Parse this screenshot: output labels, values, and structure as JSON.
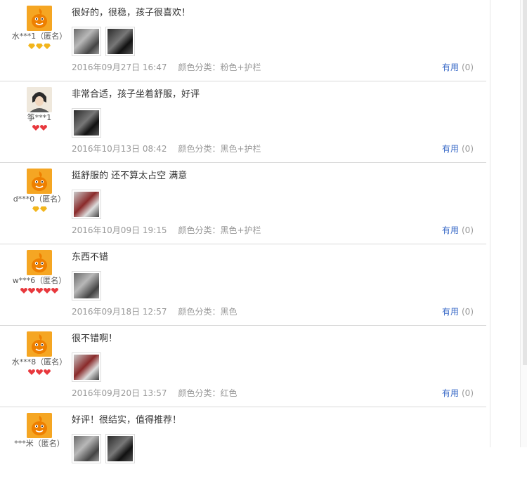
{
  "reviews": [
    {
      "user": "水***1（匿名）",
      "avatar_icon": "orange-mascot-avatar",
      "badge": {
        "type": "gold-diamond",
        "count": 3
      },
      "text": "很好的，很稳，孩子很喜欢！",
      "photos": 2,
      "date": "2016年09月27日 16:47",
      "sku": "颜色分类：粉色+护栏",
      "useful_label": "有用",
      "useful_count": "(0)"
    },
    {
      "user": "筝***1",
      "avatar_icon": "photo-avatar",
      "badge": {
        "type": "red-heart",
        "count": 2
      },
      "text": "非常合适，孩子坐着舒服，好评",
      "photos": 1,
      "date": "2016年10月13日 08:42",
      "sku": "颜色分类：黑色+护栏",
      "useful_label": "有用",
      "useful_count": "(0)"
    },
    {
      "user": "d***0（匿名）",
      "avatar_icon": "orange-mascot-avatar",
      "badge": {
        "type": "gold-diamond",
        "count": 2
      },
      "text": "挺舒服的 还不算太占空 满意",
      "photos": 1,
      "date": "2016年10月09日 19:15",
      "sku": "颜色分类：黑色+护栏",
      "useful_label": "有用",
      "useful_count": "(0)"
    },
    {
      "user": "w***6（匿名）",
      "avatar_icon": "orange-mascot-avatar",
      "badge": {
        "type": "red-heart",
        "count": 5
      },
      "text": "东西不错",
      "photos": 1,
      "date": "2016年09月18日 12:57",
      "sku": "颜色分类：黑色",
      "useful_label": "有用",
      "useful_count": "(0)"
    },
    {
      "user": "水***8（匿名）",
      "avatar_icon": "orange-mascot-avatar",
      "badge": {
        "type": "red-heart",
        "count": 3
      },
      "text": "很不错啊！",
      "photos": 1,
      "date": "2016年09月20日 13:57",
      "sku": "颜色分类：红色",
      "useful_label": "有用",
      "useful_count": "(0)"
    },
    {
      "user": "***米（匿名）",
      "avatar_icon": "orange-mascot-avatar",
      "badge": {
        "type": "none",
        "count": 0
      },
      "text": "好评！很结实，值得推荐！",
      "photos": 2,
      "date": "",
      "sku": "",
      "useful_label": "",
      "useful_count": ""
    }
  ],
  "colors": {
    "link": "#3c6cc8",
    "meta": "#999999",
    "avatar": "#f5a623",
    "gold": "#f2b51c",
    "red": "#e8383d"
  }
}
